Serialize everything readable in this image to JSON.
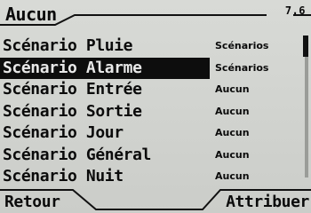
{
  "header": {
    "title": "Aucun",
    "version": "7.6"
  },
  "list": {
    "items": [
      {
        "name": "Scénario Pluie",
        "assignment": "Scénarios",
        "selected": false
      },
      {
        "name": "Scénario Alarme",
        "assignment": "Scénarios",
        "selected": true
      },
      {
        "name": "Scénario Entrée",
        "assignment": "Aucun",
        "selected": false
      },
      {
        "name": "Scénario Sortie",
        "assignment": "Aucun",
        "selected": false
      },
      {
        "name": "Scénario Jour",
        "assignment": "Aucun",
        "selected": false
      },
      {
        "name": "Scénario Général",
        "assignment": "Aucun",
        "selected": false
      },
      {
        "name": "Scénario Nuit",
        "assignment": "Aucun",
        "selected": false
      }
    ]
  },
  "footer": {
    "left_label": "Retour",
    "right_label": "Attribuer"
  },
  "colors": {
    "screen_background": "#cfd1cd",
    "text": "#0b0b0b",
    "selection_background": "#0d0d0d",
    "selection_text": "#e8e8e8"
  }
}
